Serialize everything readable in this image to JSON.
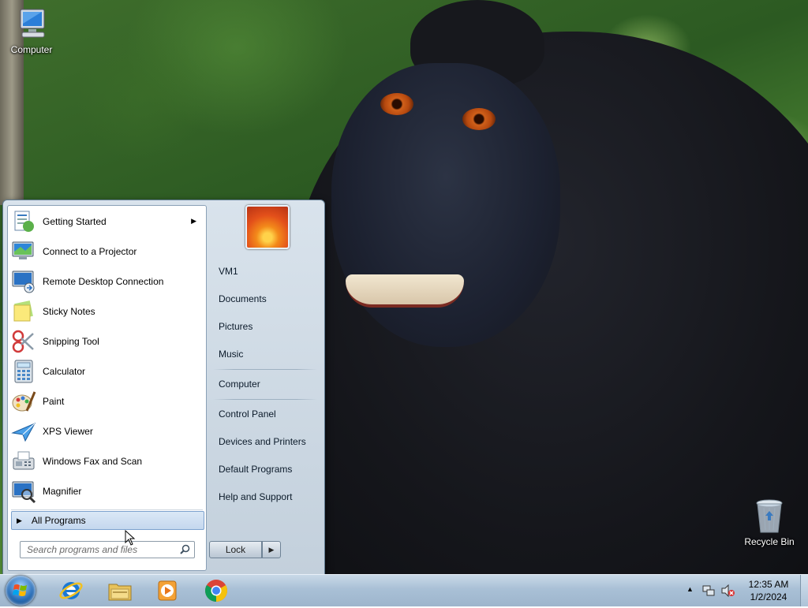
{
  "desktop": {
    "icons": [
      {
        "label": "Computer",
        "icon": "computer-icon"
      },
      {
        "label": "Recycle Bin",
        "icon": "recycle-bin-icon"
      }
    ]
  },
  "start_menu": {
    "programs": [
      {
        "label": "Getting Started",
        "icon": "getting-started-icon",
        "has_submenu": true
      },
      {
        "label": "Connect to a Projector",
        "icon": "projector-icon"
      },
      {
        "label": "Remote Desktop Connection",
        "icon": "remote-desktop-icon"
      },
      {
        "label": "Sticky Notes",
        "icon": "sticky-notes-icon"
      },
      {
        "label": "Snipping Tool",
        "icon": "snipping-tool-icon"
      },
      {
        "label": "Calculator",
        "icon": "calculator-icon"
      },
      {
        "label": "Paint",
        "icon": "paint-icon"
      },
      {
        "label": "XPS Viewer",
        "icon": "xps-viewer-icon"
      },
      {
        "label": "Windows Fax and Scan",
        "icon": "fax-scan-icon"
      },
      {
        "label": "Magnifier",
        "icon": "magnifier-icon"
      }
    ],
    "all_programs_label": "All Programs",
    "search": {
      "placeholder": "Search programs and files"
    },
    "right_pane": {
      "user_picture_icon": "user-picture-flower",
      "items": [
        {
          "label": "VM1"
        },
        {
          "label": "Documents"
        },
        {
          "label": "Pictures"
        },
        {
          "label": "Music"
        },
        {
          "label": "Computer"
        },
        {
          "label": "Control Panel"
        },
        {
          "label": "Devices and Printers"
        },
        {
          "label": "Default Programs"
        },
        {
          "label": "Help and Support"
        }
      ]
    },
    "power": {
      "lock_label": "Lock"
    }
  },
  "taskbar": {
    "pinned": [
      {
        "name": "Internet Explorer",
        "icon": "internet-explorer-icon"
      },
      {
        "name": "Windows Explorer",
        "icon": "file-explorer-icon"
      },
      {
        "name": "Windows Media Player",
        "icon": "media-player-icon"
      },
      {
        "name": "Google Chrome",
        "icon": "chrome-icon"
      }
    ],
    "tray": {
      "icons": [
        "show-hidden-icons-icon",
        "network-icon",
        "volume-muted-icon"
      ],
      "clock": {
        "time": "12:35 AM",
        "date": "1/2/2024"
      }
    }
  }
}
